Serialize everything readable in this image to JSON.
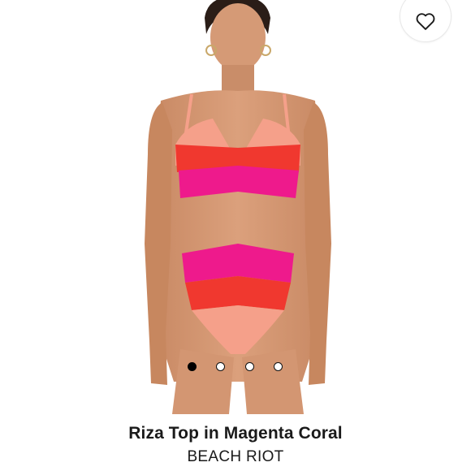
{
  "product": {
    "title": "Riza Top in Magenta Coral",
    "brand": "BEACH RIOT"
  },
  "favorite": {
    "icon": "heart-outline-icon"
  },
  "carousel": {
    "count": 4,
    "active_index": 0
  },
  "colors": {
    "magenta": "#ee1a8c",
    "red": "#f0382f",
    "coral": "#f5a08a"
  }
}
